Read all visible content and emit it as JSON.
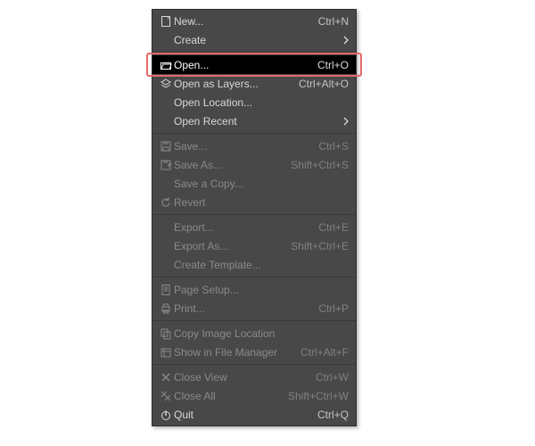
{
  "menu": {
    "sections": [
      [
        {
          "id": "new",
          "icon": "new",
          "label": "New...",
          "accel": "Ctrl+N"
        },
        {
          "id": "create",
          "icon": null,
          "label": "Create",
          "submenu": true
        }
      ],
      [
        {
          "id": "open",
          "icon": "open",
          "label": "Open...",
          "accel": "Ctrl+O",
          "highlight": true
        },
        {
          "id": "open-layers",
          "icon": "open-layers",
          "label": "Open as Layers...",
          "accel": "Ctrl+Alt+O"
        },
        {
          "id": "open-location",
          "icon": null,
          "label": "Open Location..."
        },
        {
          "id": "open-recent",
          "icon": null,
          "label": "Open Recent",
          "submenu": true
        }
      ],
      [
        {
          "id": "save",
          "icon": "save",
          "label": "Save...",
          "accel": "Ctrl+S",
          "disabled": true
        },
        {
          "id": "save-as",
          "icon": "save-as",
          "label": "Save As...",
          "accel": "Shift+Ctrl+S",
          "disabled": true
        },
        {
          "id": "save-copy",
          "icon": null,
          "label": "Save a Copy...",
          "disabled": true
        },
        {
          "id": "revert",
          "icon": "revert",
          "label": "Revert",
          "disabled": true
        }
      ],
      [
        {
          "id": "export",
          "icon": null,
          "label": "Export...",
          "accel": "Ctrl+E",
          "disabled": true
        },
        {
          "id": "export-as",
          "icon": null,
          "label": "Export As...",
          "accel": "Shift+Ctrl+E",
          "disabled": true
        },
        {
          "id": "create-template",
          "icon": null,
          "label": "Create Template...",
          "disabled": true
        }
      ],
      [
        {
          "id": "page-setup",
          "icon": "page-setup",
          "label": "Page Setup...",
          "disabled": true
        },
        {
          "id": "print",
          "icon": "print",
          "label": "Print...",
          "accel": "Ctrl+P",
          "disabled": true
        }
      ],
      [
        {
          "id": "copy-image-location",
          "icon": "copy",
          "label": "Copy Image Location",
          "disabled": true
        },
        {
          "id": "show-in-file-mgr",
          "icon": "file-manager",
          "label": "Show in File Manager",
          "accel": "Ctrl+Alt+F",
          "disabled": true
        }
      ],
      [
        {
          "id": "close-view",
          "icon": "close",
          "label": "Close View",
          "accel": "Ctrl+W",
          "disabled": true
        },
        {
          "id": "close-all",
          "icon": "close-all",
          "label": "Close All",
          "accel": "Shift+Ctrl+W",
          "disabled": true
        },
        {
          "id": "quit",
          "icon": "quit",
          "label": "Quit",
          "accel": "Ctrl+Q"
        }
      ]
    ]
  },
  "callout": {
    "target": "open"
  }
}
